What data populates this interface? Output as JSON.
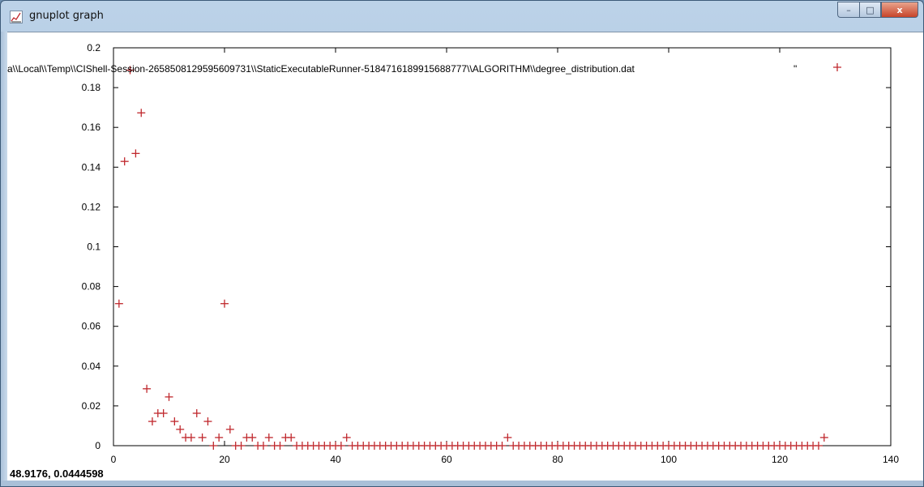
{
  "window": {
    "title": "gnuplot graph",
    "app_icon": "gnuplot-graph-icon",
    "controls": {
      "minimize": "–",
      "maximize": "□",
      "close": "x"
    }
  },
  "status": {
    "coordinates": "48.9176,  0.0444598"
  },
  "colors": {
    "points": "#c0282d",
    "axis": "#000000"
  },
  "chart_data": {
    "type": "scatter",
    "legend": "a\\\\Local\\\\Temp\\\\CIShell-Session-2658508129595609731\\\\StaticExecutableRunner-5184716189915688777\\\\ALGORITHM\\\\degree_distribution.dat",
    "legend_quote": "\"",
    "legend_position": "top-right",
    "xlim": [
      0,
      140
    ],
    "ylim": [
      0,
      0.2
    ],
    "xticks": [
      0,
      20,
      40,
      60,
      80,
      100,
      120,
      140
    ],
    "yticks": [
      0,
      0.02,
      0.04,
      0.06,
      0.08,
      0.1,
      0.12,
      0.14,
      0.16,
      0.18,
      0.2
    ],
    "xticklabels": [
      "0",
      "20",
      "40",
      "60",
      "80",
      "100",
      "120",
      "140"
    ],
    "yticklabels": [
      "0",
      "0.02",
      "0.04",
      "0.06",
      "0.08",
      "0.1",
      "0.12",
      "0.14",
      "0.16",
      "0.18",
      "0.2"
    ],
    "grid": false,
    "x": [
      1,
      2,
      3,
      4,
      5,
      6,
      7,
      8,
      9,
      10,
      11,
      12,
      13,
      14,
      15,
      16,
      17,
      18,
      19,
      20,
      21,
      22,
      23,
      24,
      25,
      26,
      27,
      28,
      29,
      30,
      31,
      32,
      33,
      34,
      35,
      36,
      37,
      38,
      39,
      40,
      41,
      42,
      43,
      44,
      45,
      46,
      47,
      48,
      49,
      50,
      51,
      52,
      53,
      54,
      55,
      56,
      57,
      58,
      59,
      60,
      61,
      62,
      63,
      64,
      65,
      66,
      67,
      68,
      69,
      70,
      71,
      72,
      73,
      74,
      75,
      76,
      77,
      78,
      79,
      80,
      81,
      82,
      83,
      84,
      85,
      86,
      87,
      88,
      89,
      90,
      91,
      92,
      93,
      94,
      95,
      96,
      97,
      98,
      99,
      100,
      101,
      102,
      103,
      104,
      105,
      106,
      107,
      108,
      109,
      110,
      111,
      112,
      113,
      114,
      115,
      116,
      117,
      118,
      119,
      120,
      121,
      122,
      123,
      124,
      125,
      126,
      127,
      128
    ],
    "y": [
      0.0714,
      0.1429,
      0.1888,
      0.1469,
      0.1673,
      0.0286,
      0.0122,
      0.0163,
      0.0163,
      0.0245,
      0.0122,
      0.0082,
      0.0041,
      0.0041,
      0.0163,
      0.0041,
      0.0122,
      0,
      0.0041,
      0.0714,
      0.0082,
      0,
      0,
      0.0041,
      0.0041,
      0,
      0,
      0.0041,
      0,
      0,
      0.0041,
      0.0041,
      0,
      0,
      0,
      0,
      0,
      0,
      0,
      0,
      0,
      0.0041,
      0,
      0,
      0,
      0,
      0,
      0,
      0,
      0,
      0,
      0,
      0,
      0,
      0,
      0,
      0,
      0,
      0,
      0,
      0,
      0,
      0,
      0,
      0,
      0,
      0,
      0,
      0,
      0,
      0.0041,
      0,
      0,
      0,
      0,
      0,
      0,
      0,
      0,
      0,
      0,
      0,
      0,
      0,
      0,
      0,
      0,
      0,
      0,
      0,
      0,
      0,
      0,
      0,
      0,
      0,
      0,
      0,
      0,
      0,
      0,
      0,
      0,
      0,
      0,
      0,
      0,
      0,
      0,
      0,
      0,
      0,
      0,
      0,
      0,
      0,
      0,
      0,
      0,
      0,
      0,
      0,
      0,
      0,
      0,
      0,
      0,
      0.0041
    ]
  }
}
